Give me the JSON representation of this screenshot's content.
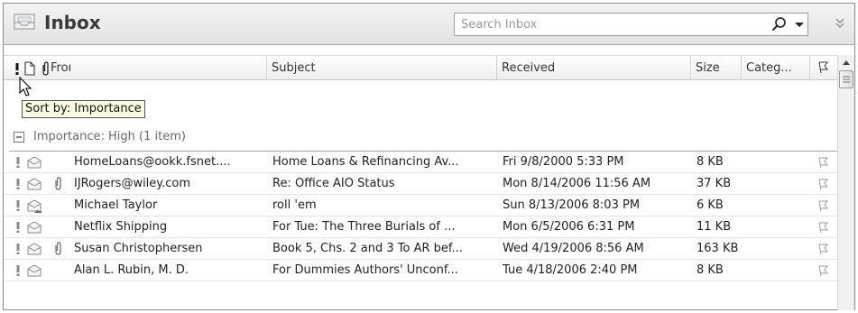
{
  "window": {
    "title": "Inbox",
    "search_placeholder": "Search Inbox"
  },
  "columns": {
    "from": "From",
    "subject": "Subject",
    "received": "Received",
    "size": "Size",
    "categories": "Categ..."
  },
  "tooltip": "Sort by: Importance",
  "group": {
    "label": "Importance: High (1 item)"
  },
  "messages": [
    {
      "from": "HomeLoans@ookk.fsnet....",
      "subject": "Home Loans & Refinancing Av...",
      "received": "Fri 9/8/2000 5:33 PM",
      "size": "8 KB",
      "attachment": false,
      "icon": "envelope-icon"
    },
    {
      "from": "IJRogers@wiley.com",
      "subject": "Re: Office AIO Status",
      "received": "Mon 8/14/2006 11:56 AM",
      "size": "37 KB",
      "attachment": true,
      "icon": "envelope-icon"
    },
    {
      "from": "Michael Taylor",
      "subject": "roll 'em",
      "received": "Sun 8/13/2006 8:03 PM",
      "size": "6 KB",
      "attachment": false,
      "icon": "replied-envelope-icon"
    },
    {
      "from": "Netflix Shipping",
      "subject": "For Tue: The Three Burials of ...",
      "received": "Mon 6/5/2006 6:31 PM",
      "size": "11 KB",
      "attachment": false,
      "icon": "envelope-icon"
    },
    {
      "from": "Susan Christophersen",
      "subject": "Book 5, Chs. 2 and 3 To AR bef...",
      "received": "Wed 4/19/2006 8:56 AM",
      "size": "163 KB",
      "attachment": true,
      "icon": "envelope-icon"
    },
    {
      "from": "Alan L. Rubin, M. D.",
      "subject": "For Dummies Authors' Unconf...",
      "received": "Tue 4/18/2006 2:40 PM",
      "size": "8 KB",
      "attachment": false,
      "icon": "envelope-icon"
    }
  ]
}
